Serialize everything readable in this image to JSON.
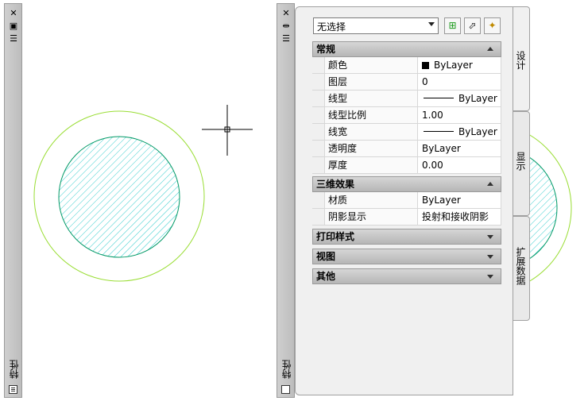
{
  "left_strip": {
    "close_icon": "close-icon",
    "expand_icon": "auto-hide-icon",
    "menu_icon": "properties-menu-icon",
    "title": "特性"
  },
  "panel_strip": {
    "close_icon": "close-icon",
    "expand_icon": "auto-hide-icon",
    "menu_icon": "properties-menu-icon",
    "title": "特性"
  },
  "selection": {
    "value": "无选择"
  },
  "toolbar": {
    "toggle_pickadd_icon": "toggle-pickadd-icon",
    "select_objects_icon": "select-objects-icon",
    "quick_select_icon": "quick-select-icon"
  },
  "groups": {
    "general": {
      "title": "常规",
      "rows": [
        {
          "name": "颜色",
          "value": "ByLayer"
        },
        {
          "name": "图层",
          "value": "0"
        },
        {
          "name": "线型",
          "value": "ByLayer"
        },
        {
          "name": "线型比例",
          "value": "1.00"
        },
        {
          "name": "线宽",
          "value": "ByLayer"
        },
        {
          "name": "透明度",
          "value": "ByLayer"
        },
        {
          "name": "厚度",
          "value": "0.00"
        }
      ]
    },
    "three_d": {
      "title": "三维效果",
      "rows": [
        {
          "name": "材质",
          "value": "ByLayer"
        },
        {
          "name": "阴影显示",
          "value": "投射和接收阴影"
        }
      ]
    },
    "plot_style": {
      "title": "打印样式"
    },
    "view": {
      "title": "视图"
    },
    "misc": {
      "title": "其他"
    }
  },
  "tabs": [
    "设计",
    "显示",
    "扩展数据"
  ],
  "colors": {
    "circle_outer": "#99dd33",
    "hatch": "#33cccc",
    "hatch_edge": "#009966"
  }
}
